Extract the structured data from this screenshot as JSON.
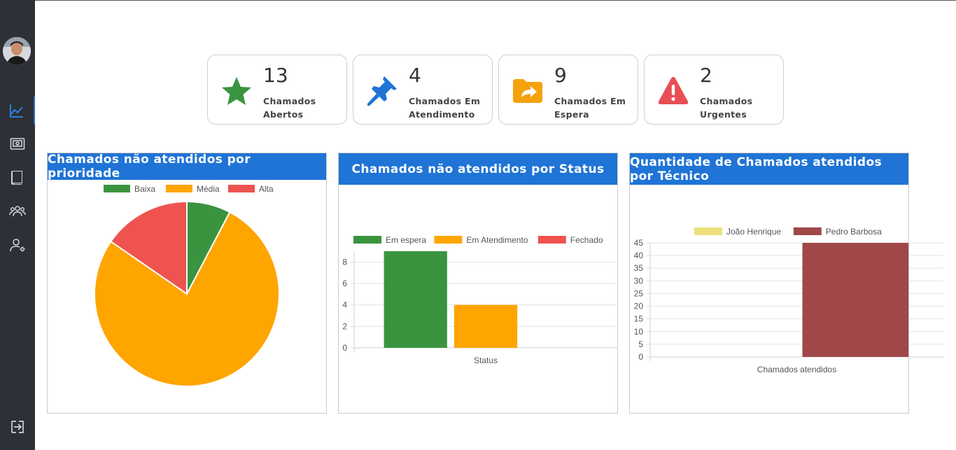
{
  "sidebar": {
    "items": [
      {
        "name": "dashboard",
        "icon": "line-chart-icon",
        "active": true
      },
      {
        "name": "tickets",
        "icon": "screen-board-icon",
        "active": false
      },
      {
        "name": "knowledge-base",
        "icon": "book-icon",
        "active": false
      },
      {
        "name": "teams",
        "icon": "users-group-icon",
        "active": false
      },
      {
        "name": "user-settings",
        "icon": "user-gear-icon",
        "active": false
      }
    ],
    "logout_icon": "logout-icon"
  },
  "cards": [
    {
      "count": "13",
      "label": "Chamados Abertos",
      "icon": "star-icon",
      "color": "#3a943f"
    },
    {
      "count": "4",
      "label": "Chamados Em Atendimento",
      "icon": "pushpin-icon",
      "color": "#1f74d6"
    },
    {
      "count": "9",
      "label": "Chamados Em Espera",
      "icon": "folder-share-icon",
      "color": "#f5a20b"
    },
    {
      "count": "2",
      "label": "Chamados Urgentes",
      "icon": "warning-icon",
      "color": "#e94e55"
    }
  ],
  "panels": {
    "priority": {
      "title": "Chamados não atendidos por prioridade"
    },
    "status": {
      "title": "Chamados não atendidos por Status"
    },
    "tech": {
      "title": "Quantidade de Chamados atendidos por Técnico"
    }
  },
  "chart_data": [
    {
      "type": "pie",
      "title": "Chamados não atendidos por prioridade",
      "labels": [
        "Baixa",
        "Média",
        "Alta"
      ],
      "values": [
        1,
        10,
        2
      ],
      "colors": [
        "#3a943f",
        "#ffa500",
        "#ef5350"
      ],
      "legend": "top"
    },
    {
      "type": "bar",
      "title": "Chamados não atendidos por Status",
      "xlabel": "Status",
      "categories": [
        "Status"
      ],
      "series": [
        {
          "name": "Em espera",
          "values": [
            9
          ],
          "color": "#3a943f"
        },
        {
          "name": "Em Atendimento",
          "values": [
            4
          ],
          "color": "#ffa500"
        },
        {
          "name": "Fechado",
          "values": [
            0
          ],
          "color": "#ef5350"
        }
      ],
      "ylim": [
        0,
        9
      ],
      "yticks": [
        0,
        2,
        4,
        6,
        8
      ],
      "legend": "top",
      "grid": true
    },
    {
      "type": "bar",
      "title": "Quantidade de Chamados atendidos por Técnico",
      "xlabel": "Chamados atendidos",
      "categories": [
        "Chamados atendidos"
      ],
      "series": [
        {
          "name": "João Henrique",
          "values": [
            0
          ],
          "color": "#ece07e"
        },
        {
          "name": "Pedro Barbosa",
          "values": [
            45
          ],
          "color": "#a0474a"
        }
      ],
      "ylim": [
        0,
        45
      ],
      "yticks": [
        0,
        5,
        10,
        15,
        20,
        25,
        30,
        35,
        40,
        45
      ],
      "legend": "top",
      "grid": true
    }
  ]
}
